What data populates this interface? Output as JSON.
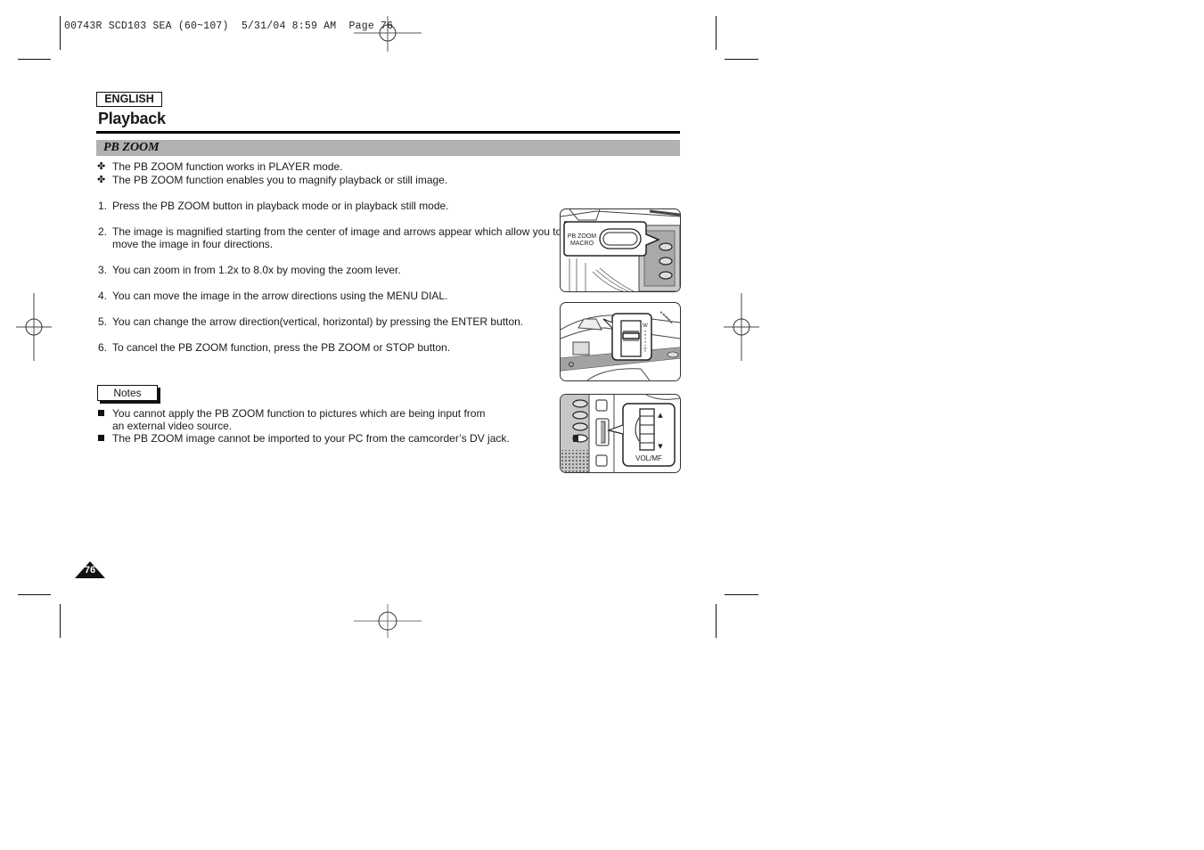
{
  "slug": {
    "text": "00743R SCD103 SEA (60~107)  5/31/04 8:59 AM  Page 76"
  },
  "header": {
    "language": "ENGLISH",
    "title": "Playback"
  },
  "section": {
    "title": "PB ZOOM"
  },
  "intro_bullets": [
    {
      "icon": "cross-bullet-icon",
      "glyph": "✤",
      "text": "The PB ZOOM function works in PLAYER mode."
    },
    {
      "icon": "cross-bullet-icon",
      "glyph": "✤",
      "text": "The PB ZOOM function enables you to magnify playback or still image."
    }
  ],
  "steps": [
    {
      "num": "1.",
      "lines": [
        "Press the PB ZOOM button in playback mode or in playback still mode."
      ]
    },
    {
      "num": "2.",
      "lines": [
        "The image is magnified starting from the center of image and arrows appear which allow you to",
        "move the image in four directions."
      ]
    },
    {
      "num": "3.",
      "lines": [
        "You can zoom in from 1.2x to 8.0x by moving the zoom lever."
      ]
    },
    {
      "num": "4.",
      "lines": [
        "You can move the image in the arrow directions using the MENU DIAL."
      ]
    },
    {
      "num": "5.",
      "lines": [
        "You can change the arrow direction(vertical, horizontal) by pressing the ENTER button."
      ]
    },
    {
      "num": "6.",
      "lines": [
        "To cancel the PB ZOOM function, press the PB ZOOM or STOP button."
      ]
    }
  ],
  "notes": {
    "label": "Notes",
    "items": [
      {
        "lines": [
          "You cannot apply the PB ZOOM function to pictures which are being input from",
          "an external video source."
        ]
      },
      {
        "lines": [
          "The PB ZOOM image cannot be imported to your PC from the camcorder’s DV jack."
        ]
      }
    ]
  },
  "illustrations": [
    {
      "name": "pb-zoom-button-illustration",
      "labels": [
        "PB ZOOM",
        "MACRO"
      ]
    },
    {
      "name": "zoom-lever-illustration",
      "labels": [
        "W",
        "T"
      ]
    },
    {
      "name": "vol-mf-dial-illustration",
      "labels": [
        "VOL/MF"
      ],
      "arrows": [
        "▲",
        "▼"
      ]
    }
  ],
  "footer": {
    "page_number": "76"
  },
  "colors": {
    "section_bar": "#b1b1b1",
    "text": "#1a1a1a",
    "rule": "#000000"
  }
}
